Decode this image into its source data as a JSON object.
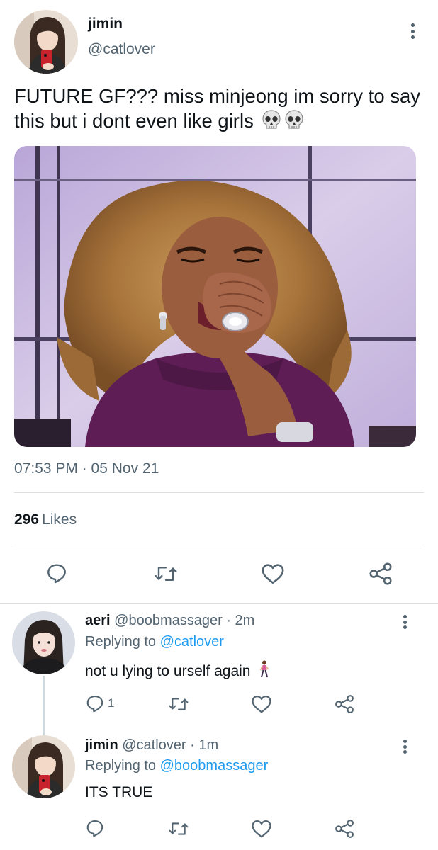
{
  "main_tweet": {
    "name": "jimin",
    "handle": "@catlover",
    "text": "FUTURE GF??? miss minjeong im sorry to say this but i dont even like girls",
    "emojis": [
      "skull-emoji",
      "skull-emoji"
    ],
    "timestamp": "07:53 PM · 05 Nov 21",
    "likes_count": "296",
    "likes_label": "Likes",
    "actions": [
      "reply-icon",
      "retweet-icon",
      "like-icon",
      "share-icon"
    ]
  },
  "replies": [
    {
      "name": "aeri",
      "handle_time": "@boobmassager · 2m",
      "replying_label": "Replying to",
      "replying_to": "@catlover",
      "text": "not u lying to urself again",
      "emoji": "woman-walking-emoji",
      "reply_count": "1"
    },
    {
      "name": "jimin",
      "handle_time": "@catlover · 1m",
      "replying_label": "Replying to",
      "replying_to": "@boobmassager",
      "text": "ITS TRUE"
    }
  ],
  "colors": {
    "text_primary": "#0f1419",
    "text_secondary": "#536471",
    "link": "#1d9bf0",
    "divider": "#dcdfe2"
  }
}
